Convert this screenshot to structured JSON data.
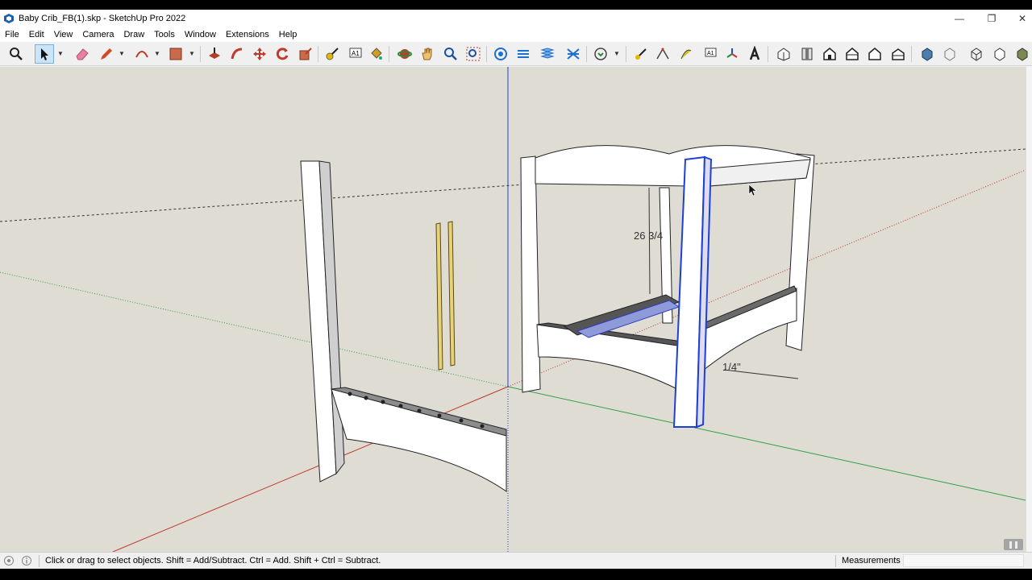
{
  "window": {
    "title": "Baby Crib_FB(1).skp - SketchUp Pro 2022",
    "minimize_glyph": "—",
    "restore_glyph": "❐",
    "close_glyph": "✕"
  },
  "menu": [
    "File",
    "Edit",
    "View",
    "Camera",
    "Draw",
    "Tools",
    "Window",
    "Extensions",
    "Help"
  ],
  "toolbar": {
    "tools": [
      "zoom-extents",
      "select",
      "eraser",
      "pencil",
      "arc",
      "paint-bucket",
      "push-pull",
      "follow-me",
      "move",
      "rotate",
      "scale",
      "tape-measure",
      "text",
      "paint",
      "orbit",
      "pan",
      "zoom",
      "zoom-window",
      "section-plane",
      "section-display",
      "section-cut",
      "section-fill",
      "components",
      "tape",
      "protractor",
      "axes-flag",
      "dimension",
      "axes",
      "3d-text",
      "iso-view",
      "front-view",
      "home",
      "back-view",
      "right-view",
      "left-view",
      "xray",
      "wireframe",
      "hidden-line",
      "shaded",
      "textured"
    ],
    "active_tool": "select"
  },
  "viewport": {
    "background": "#dfdcd4",
    "dimensions": [
      "26 3/4",
      "1/4\""
    ],
    "axis_colors": {
      "red": "#c0392b",
      "green": "#2ea043",
      "blue": "#1f3fd6"
    }
  },
  "statusbar": {
    "hint": "Click or drag to select objects. Shift = Add/Subtract. Ctrl = Add. Shift + Ctrl = Subtract.",
    "measurements_label": "Measurements",
    "measurements_value": ""
  }
}
